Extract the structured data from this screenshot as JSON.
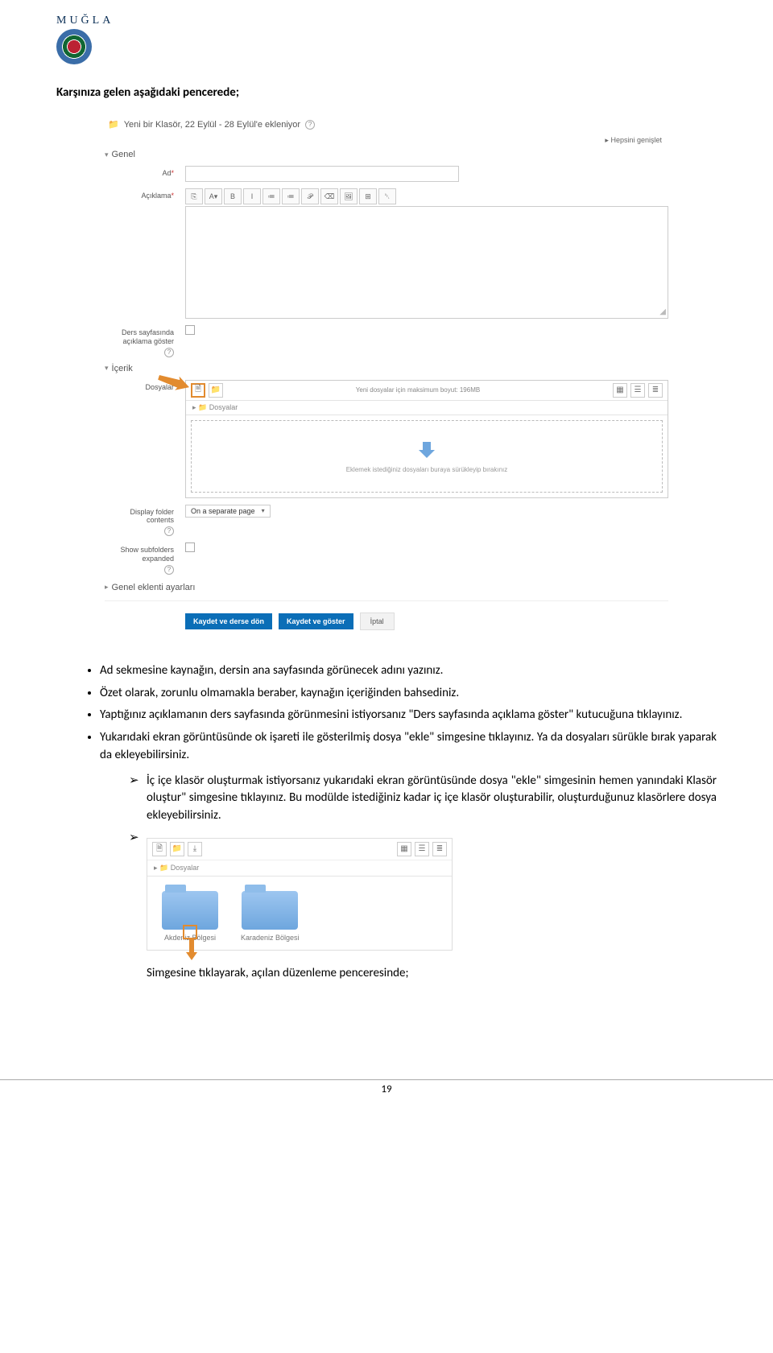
{
  "logo_text": "MUĞLA",
  "intro": "Karşınıza gelen aşağıdaki pencerede;",
  "shot": {
    "title": "Yeni bir Klasör, 22 Eylül - 28 Eylül'e ekleniyor",
    "expand_all": "Hepsini genişlet",
    "sect_genel": "Genel",
    "sect_icerik": "İçerik",
    "sect_eklenti": "Genel eklenti ayarları",
    "lbl_ad": "Ad",
    "req": "*",
    "lbl_aciklama": "Açıklama",
    "lbl_ders_goster": "Ders sayfasında açıklama göster",
    "lbl_dosyalar": "Dosyalar",
    "lbl_display": "Display folder contents",
    "lbl_subfolders": "Show subfolders expanded",
    "file_hint": "Yeni dosyalar için maksimum boyut: 196MB",
    "file_path": "Dosyalar",
    "drop_text": "Eklemek istediğiniz dosyaları buraya sürükleyip bırakınız",
    "display_opt": "On a separate page",
    "btn_save_return": "Kaydet ve derse dön",
    "btn_save_show": "Kaydet ve göster",
    "btn_cancel": "İptal",
    "tb": [
      "⎘",
      "A▾",
      "B",
      "I",
      "≔",
      "≔",
      "𝒫",
      "⌫",
      "🖼",
      "⊞",
      "␡"
    ]
  },
  "bullets": [
    "Ad sekmesine kaynağın, dersin ana sayfasında görünecek adını yazınız.",
    "Özet olarak, zorunlu olmamakla beraber, kaynağın içeriğinden bahsediniz.",
    "Yaptığınız açıklamanın ders sayfasında görünmesini istiyorsanız \"Ders sayfasında açıklama göster\" kutucuğuna tıklayınız.",
    "Yukarıdaki ekran görüntüsünde ok işareti ile gösterilmiş dosya \"ekle\" simgesine tıklayınız. Ya da dosyaları sürükle bırak yaparak da ekleyebilirsiniz."
  ],
  "sub": {
    "text": "İç içe klasör oluşturmak istiyorsanız yukarıdaki ekran görüntüsünde dosya \"ekle\" simgesinin hemen yanındaki Klasör oluştur\" simgesine tıklayınız. Bu modülde istediğiniz kadar iç içe klasör oluşturabilir, oluşturduğunuz klasörlere dosya ekleyebilirsiniz."
  },
  "shot2": {
    "path": "Dosyalar",
    "folder1": "Akdeniz Bölgesi",
    "folder2": "Karadeniz Bölgesi"
  },
  "after_shot": "Simgesine tıklayarak, açılan düzenleme penceresinde;",
  "page_num": "19"
}
